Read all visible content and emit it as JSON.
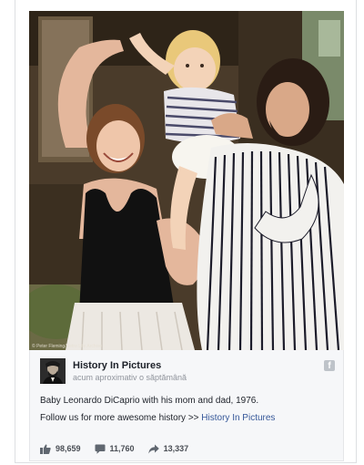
{
  "photo": {
    "credit": "© Peter Fleming/Retro Life Archive"
  },
  "post": {
    "page_name": "History In Pictures",
    "timestamp": "acum aproximativ o săptămână",
    "caption": "Baby Leonardo DiCaprio with his mom and dad, 1976.",
    "follow_prefix": "Follow us for more awesome history >> ",
    "follow_link": "History In Pictures",
    "icons": {
      "avatar": "lincoln-portrait-avatar",
      "platform": "facebook-icon"
    }
  },
  "stats": {
    "likes": "98,659",
    "comments": "11,760",
    "shares": "13,337",
    "icons": [
      "like-icon",
      "comment-icon",
      "share-icon"
    ]
  },
  "colors": {
    "link": "#365899",
    "text": "#1d2129",
    "muted": "#90949c",
    "stat_text": "#4b4f56"
  }
}
